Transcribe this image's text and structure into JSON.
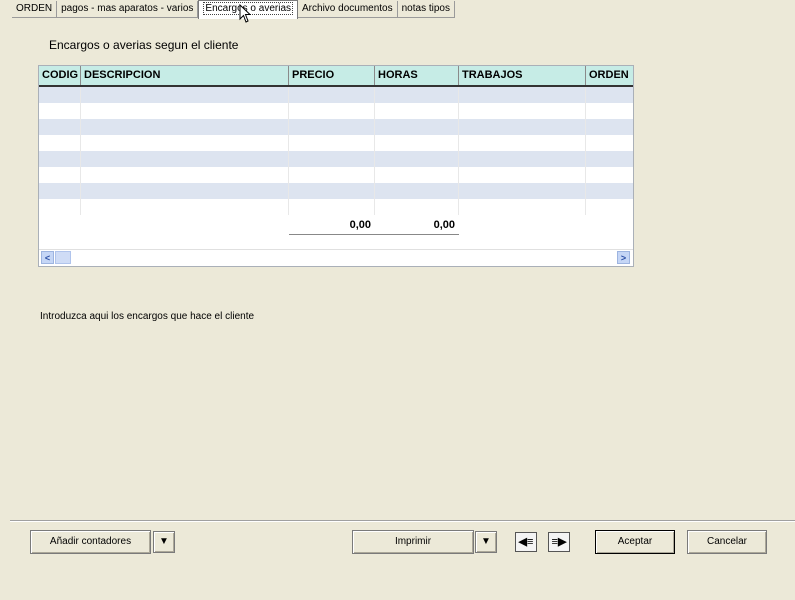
{
  "tabs": [
    {
      "label": "ORDEN",
      "active": false
    },
    {
      "label": "pagos - mas aparatos - varios",
      "active": false
    },
    {
      "label": "Encargos o averias",
      "active": true
    },
    {
      "label": "Archivo documentos",
      "active": false
    },
    {
      "label": "notas tipos",
      "active": false
    }
  ],
  "panel": {
    "title": "Encargos o averias segun el cliente",
    "hint": "Introduzca aqui los encargos que hace el cliente"
  },
  "table": {
    "columns": [
      "CODIG",
      "DESCRIPCION",
      "PRECIO",
      "HORAS",
      "TRABAJOS",
      "ORDEN"
    ],
    "rows": [
      [
        "",
        "",
        "",
        "",
        "",
        ""
      ],
      [
        "",
        "",
        "",
        "",
        "",
        ""
      ],
      [
        "",
        "",
        "",
        "",
        "",
        ""
      ],
      [
        "",
        "",
        "",
        "",
        "",
        ""
      ],
      [
        "",
        "",
        "",
        "",
        "",
        ""
      ],
      [
        "",
        "",
        "",
        "",
        "",
        ""
      ],
      [
        "",
        "",
        "",
        "",
        "",
        ""
      ],
      [
        "",
        "",
        "",
        "",
        "",
        ""
      ]
    ],
    "totals": {
      "precio": "0,00",
      "horas": "0,00"
    }
  },
  "buttons": {
    "add_counters": "Añadir contadores",
    "print": "Imprimir",
    "accept": "Aceptar",
    "cancel": "Cancelar",
    "dropdown_glyph": "▼",
    "prev_glyph": "◀≡",
    "next_glyph": "≡▶",
    "scroll_left_glyph": "<",
    "scroll_right_glyph": ">"
  },
  "icons": {
    "dropdown": "chevron-down-icon",
    "prev": "previous-record-icon",
    "next": "next-record-icon",
    "cursor": "mouse-pointer-icon"
  },
  "colors": {
    "window_bg": "#ece9d8",
    "header_bg": "#c6ece6",
    "row_alt": "#dde4f0"
  }
}
